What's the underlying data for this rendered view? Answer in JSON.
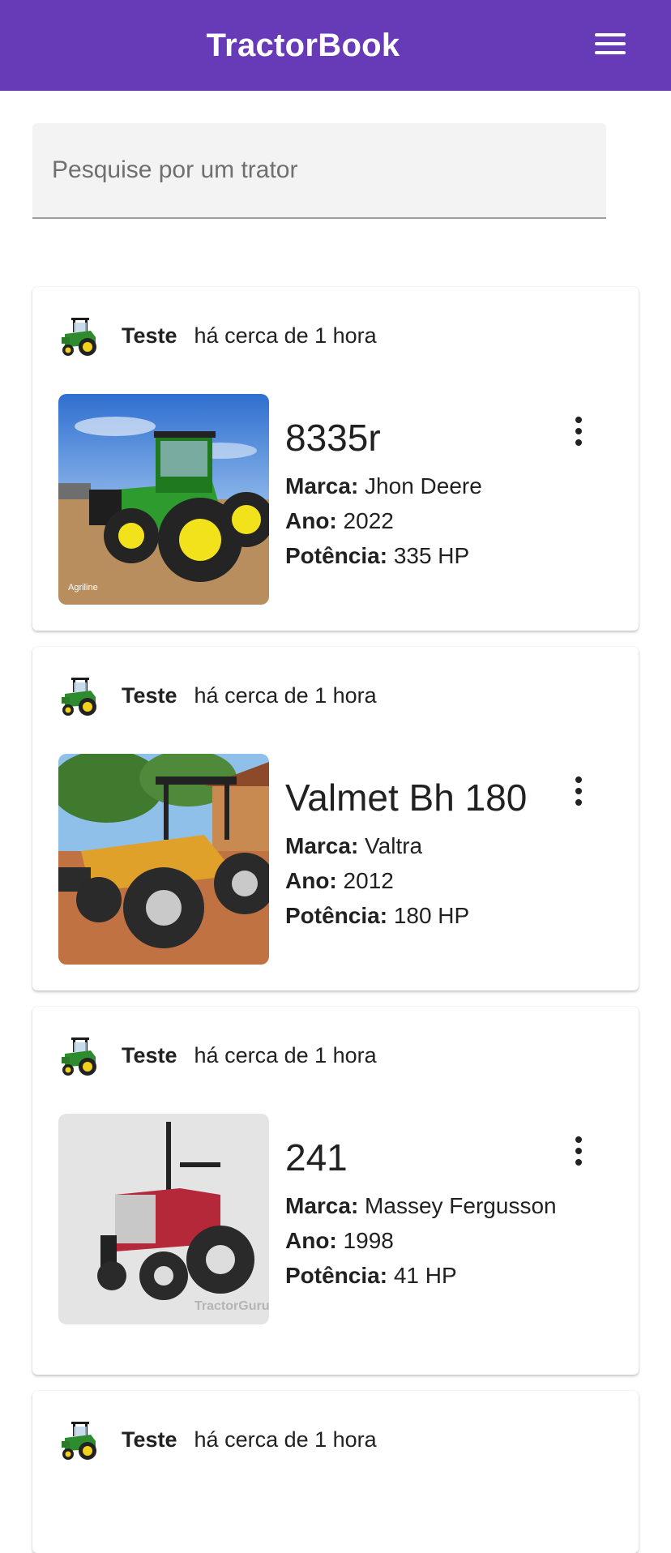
{
  "app": {
    "title": "TractorBook"
  },
  "search": {
    "placeholder": "Pesquise por um trator"
  },
  "labels": {
    "brand": "Marca:",
    "year": "Ano:",
    "power": "Potência:"
  },
  "posts": [
    {
      "author": "Teste",
      "time": "há cerca de 1 hora",
      "model": "8335r",
      "brand": "Jhon Deere",
      "year": "2022",
      "power": "335 HP",
      "watermark": "Agriline"
    },
    {
      "author": "Teste",
      "time": "há cerca de 1 hora",
      "model": "Valmet Bh 180",
      "brand": "Valtra",
      "year": "2012",
      "power": "180 HP"
    },
    {
      "author": "Teste",
      "time": "há cerca de 1 hora",
      "model": "241",
      "brand": "Massey Fergusson",
      "year": "1998",
      "power": "41 HP",
      "watermark": "TractorGuru"
    },
    {
      "author": "Teste",
      "time": "há cerca de 1 hora"
    }
  ]
}
